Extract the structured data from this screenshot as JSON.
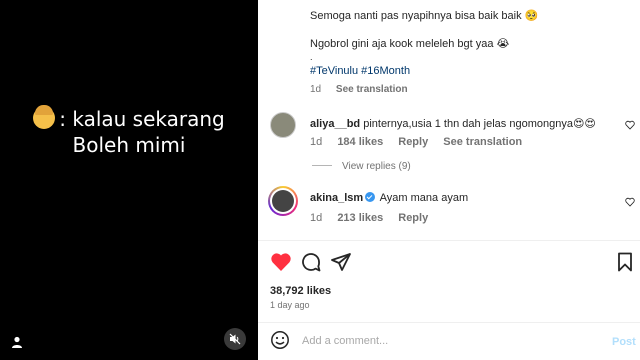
{
  "video": {
    "overlay_line1": "kalau sekarang",
    "overlay_line2": "Boleh mimi",
    "overlay_prefix": ":",
    "emoji_icon": "woman-emoji",
    "mute_icon": "muted-speaker-icon",
    "user_icon": "person-icon"
  },
  "caption": {
    "line1": "Semoga nanti pas nyapihnya bisa baik baik 🥺",
    "line2": "Ngobrol gini aja kook meleleh bgt yaa 😭",
    "dot": ".",
    "hashtags": "#TeVinulu #16Month",
    "age": "1d",
    "see_translation": "See translation"
  },
  "comments": [
    {
      "user": "aliya__bd",
      "text": "pinternya,usia 1 thn dah jelas ngomongnya😍😍",
      "age": "1d",
      "likes": "184 likes",
      "reply": "Reply",
      "see_translation": "See translation",
      "view_replies": "View replies (9)"
    },
    {
      "user": "akina_lsm",
      "verified": true,
      "text": "Ayam mana ayam",
      "age": "1d",
      "likes": "213 likes",
      "reply": "Reply"
    }
  ],
  "post": {
    "likes": "38,792 likes",
    "age": "1 day ago",
    "liked": true,
    "like_color": "#ff3040"
  },
  "add_comment": {
    "placeholder": "Add a comment...",
    "post_label": "Post"
  },
  "colors": {
    "hashtag": "#00376b",
    "post_button": "#b2dffc",
    "muted_text": "#737373"
  }
}
